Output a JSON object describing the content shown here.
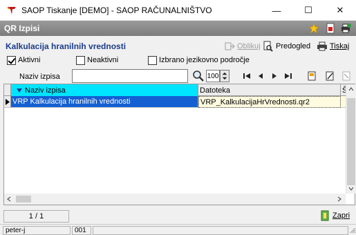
{
  "window": {
    "title": "SAOP Tiskanje [DEMO] - SAOP RAČUNALNIŠTVO",
    "minimize": "—",
    "maximize": "☐",
    "close": "✕"
  },
  "module": {
    "title": "QR Izpisi"
  },
  "form": {
    "title": "Kalkulacija hranilnih vrednosti",
    "toolbar": {
      "design_label": "Oblikuj",
      "preview_label": "Predogled",
      "print_label": "Tiskaj"
    },
    "filters": {
      "active_label": "Aktivni",
      "active_checked": true,
      "inactive_label": "Neaktivni",
      "inactive_checked": false,
      "language_label": "Izbrano jezikovno področje",
      "language_checked": false
    },
    "search": {
      "label": "Naziv izpisa",
      "value": "",
      "zoom": "100"
    }
  },
  "grid": {
    "columns": [
      "Naziv izpisa",
      "Datoteka",
      "Št"
    ],
    "rows": [
      {
        "name": "VRP Kalkulacija hranilnih vrednosti",
        "file": "VRP_KalkulacijaHrVrednosti.qr2"
      }
    ]
  },
  "footer": {
    "pager": "1 / 1",
    "close_label": "Zapri"
  },
  "status": {
    "user": "peter-j",
    "code": "001"
  },
  "colors": {
    "header_accent": "#00e5ff",
    "selected_row": "#1460d2",
    "title_blue": "#1a3c8c"
  }
}
